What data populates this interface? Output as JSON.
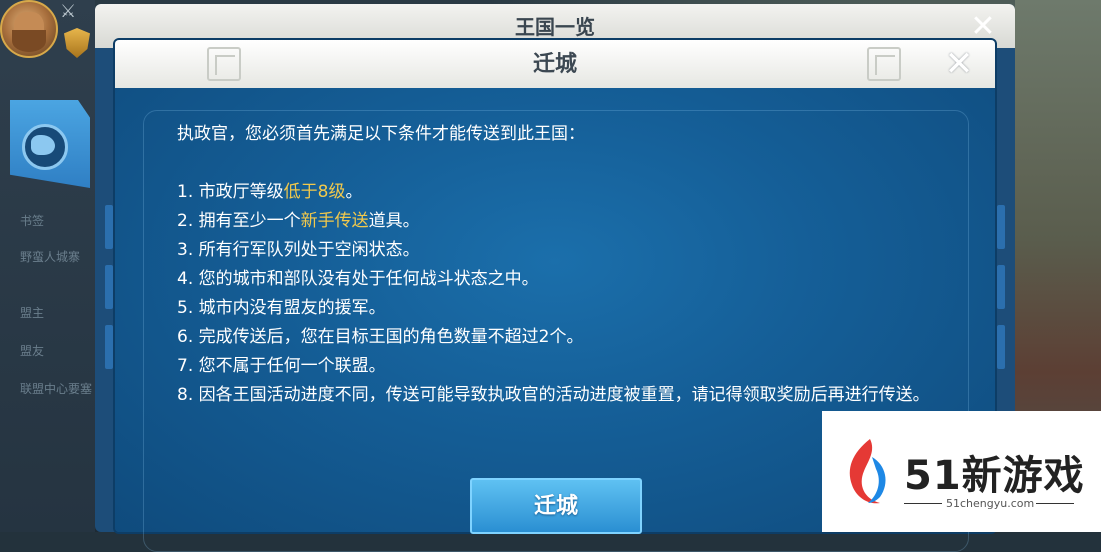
{
  "back_window": {
    "title": "王国一览",
    "close_icon": "✕"
  },
  "sidebar": {
    "labels": [
      "书签",
      "野蛮人城寨",
      "盟主",
      "盟友",
      "联盟中心要塞"
    ]
  },
  "front_window": {
    "title": "迁城",
    "close_icon": "✕",
    "intro": "执政官，您必须首先满足以下条件才能传送到此王国：",
    "conditions": [
      {
        "pre": "1. 市政厅等级",
        "highlight": "低于8级",
        "post": "。"
      },
      {
        "pre": "2. 拥有至少一个",
        "highlight": "新手传送",
        "post": "道具。"
      },
      {
        "pre": "3. 所有行军队列处于空闲状态。",
        "highlight": "",
        "post": ""
      },
      {
        "pre": "4. 您的城市和部队没有处于任何战斗状态之中。",
        "highlight": "",
        "post": ""
      },
      {
        "pre": "5. 城市内没有盟友的援军。",
        "highlight": "",
        "post": ""
      },
      {
        "pre": "6. 完成传送后，您在目标王国的角色数量不超过2个。",
        "highlight": "",
        "post": ""
      },
      {
        "pre": "7. 您不属于任何一个联盟。",
        "highlight": "",
        "post": ""
      },
      {
        "pre": "8. 因各王国活动进度不同，传送可能导致执政官的活动进度被重置，请记得领取奖励后再进行传送。",
        "highlight": "",
        "post": ""
      }
    ],
    "confirm_label": "迁城"
  },
  "watermark": {
    "brand": "51新游戏",
    "url": "51chengyu.com"
  },
  "colors": {
    "highlight": "#f2c94c",
    "panel": "#155f98",
    "button": "#2a8fd2"
  }
}
